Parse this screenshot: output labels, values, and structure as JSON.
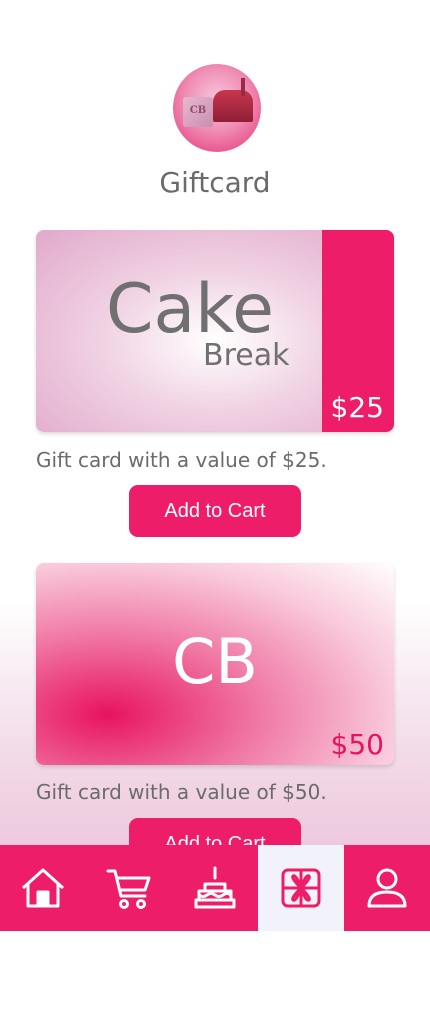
{
  "header": {
    "logo_text": "CB",
    "title": "Giftcard"
  },
  "cards": [
    {
      "brand_main": "Cake",
      "brand_sub": "Break",
      "price": "$25",
      "description": "Gift card with a value of $25.",
      "button_label": "Add to Cart"
    },
    {
      "brand_main": "CB",
      "price": "$50",
      "description": "Gift card with a value of $50.",
      "button_label": "Add to Cart"
    }
  ],
  "nav": {
    "items": [
      {
        "icon": "home-icon"
      },
      {
        "icon": "cart-icon"
      },
      {
        "icon": "cake-icon"
      },
      {
        "icon": "gift-icon",
        "active": true
      },
      {
        "icon": "user-icon"
      }
    ]
  },
  "colors": {
    "accent": "#ee1d69",
    "text": "#6b6b6b",
    "active_nav_bg": "#f2f2fa"
  }
}
